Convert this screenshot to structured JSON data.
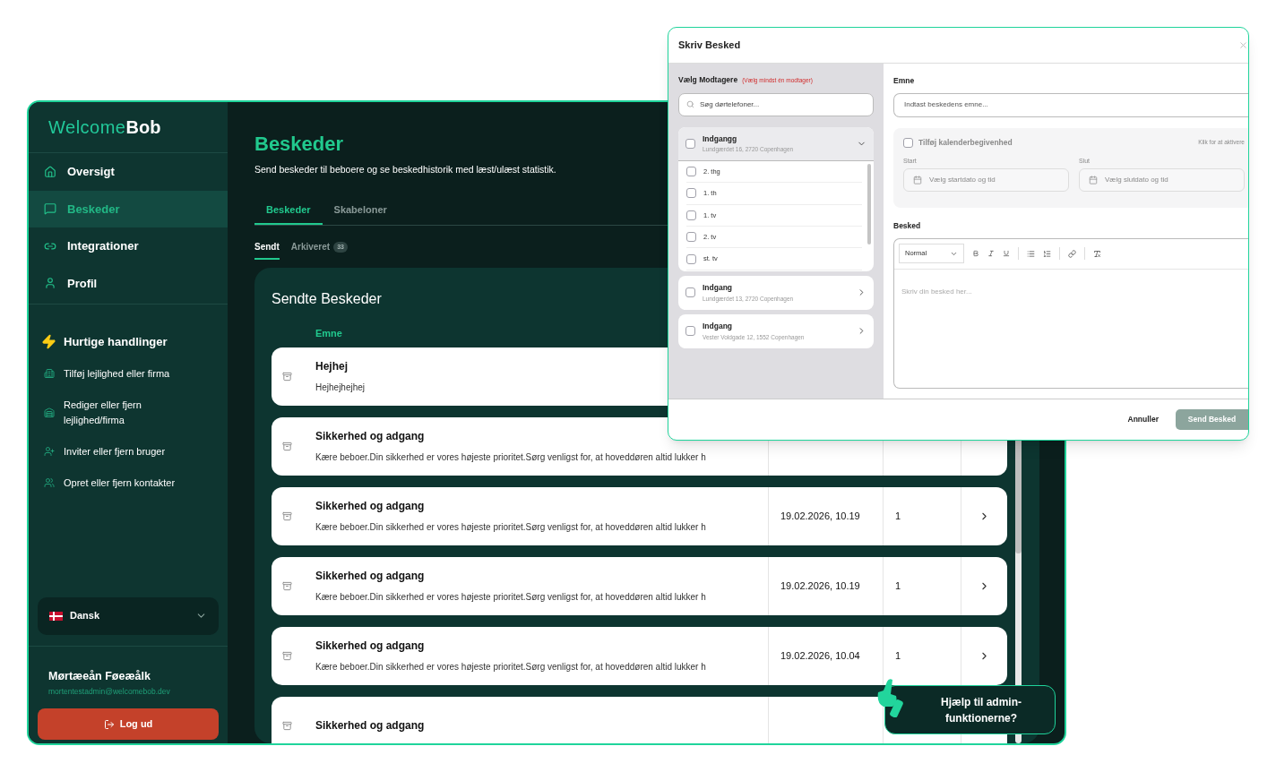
{
  "sidebar": {
    "logo": {
      "light": "Welcome",
      "bold": "Bob"
    },
    "nav": [
      {
        "label": "Oversigt",
        "selected": false
      },
      {
        "label": "Beskeder",
        "selected": true
      },
      {
        "label": "Integrationer",
        "selected": false
      },
      {
        "label": "Profil",
        "selected": false
      }
    ],
    "quick_actions": {
      "title": "Hurtige handlinger",
      "items": [
        "Tilføj lejlighed eller firma",
        "Rediger eller fjern lejlighed/firma",
        "Inviter eller fjern bruger",
        "Opret eller fjern kontakter"
      ]
    },
    "language": "Dansk",
    "user": {
      "name": "Mørtæeån Føeæålk",
      "email": "mortentestadmin@welcomebob.dev"
    },
    "logout": "Log ud"
  },
  "main": {
    "title": "Beskeder",
    "description": "Send beskeder til beboere og se beskedhistorik med læst/ulæst statistik.",
    "tabs": [
      {
        "label": "Beskeder",
        "selected": true
      },
      {
        "label": "Skabeloner",
        "selected": false
      }
    ],
    "subtabs": [
      {
        "label": "Sendt",
        "selected": true
      },
      {
        "label": "Arkiveret",
        "selected": false,
        "count": "33"
      }
    ],
    "card": {
      "title": "Sendte Beskeder",
      "columns": [
        "Emne"
      ],
      "rows": [
        {
          "subject": "Hejhej",
          "preview": "Hejhejhejhej"
        },
        {
          "subject": "Sikkerhed og adgang",
          "preview": "Kære beboer.Din sikkerhed er vores højeste prioritet.Sørg venligst for, at hoveddøren altid lukker h"
        },
        {
          "subject": "Sikkerhed og adgang",
          "preview": "Kære beboer.Din sikkerhed er vores højeste prioritet.Sørg venligst for, at hoveddøren altid lukker h",
          "date": "19.02.2026, 10.19",
          "count": "1"
        },
        {
          "subject": "Sikkerhed og adgang",
          "preview": "Kære beboer.Din sikkerhed er vores højeste prioritet.Sørg venligst for, at hoveddøren altid lukker h",
          "date": "19.02.2026, 10.19",
          "count": "1"
        },
        {
          "subject": "Sikkerhed og adgang",
          "preview": "Kære beboer.Din sikkerhed er vores højeste prioritet.Sørg venligst for, at hoveddøren altid lukker h",
          "date": "19.02.2026, 10.04",
          "count": "1"
        },
        {
          "subject": "Sikkerhed og adgang"
        }
      ]
    }
  },
  "help": "Hjælp til admin-funktionerne?",
  "modal": {
    "title": "Skriv Besked",
    "recipients": {
      "label": "Vælg Modtagere",
      "hint": "(Vælg mindst én modtager)",
      "search_placeholder": "Søg dørtelefoner...",
      "groups": [
        {
          "name": "Indgangg",
          "address": "Lundgærdet 16, 2720 Copenhagen",
          "checked": false,
          "expanded": true,
          "children": [
            {
              "label": "2. thg",
              "checked": false
            },
            {
              "label": "1. th",
              "checked": false
            },
            {
              "label": "1. tv",
              "checked": false
            },
            {
              "label": "2. tv",
              "checked": false
            },
            {
              "label": "st. tv",
              "checked": false
            }
          ]
        },
        {
          "name": "Indgang",
          "address": "Lundgærdet 13, 2720 Copenhagen",
          "checked": false,
          "expanded": false
        },
        {
          "name": "Indgang",
          "address": "Vester Voldgade 12, 1552 Copenhagen",
          "checked": false,
          "expanded": false
        }
      ]
    },
    "subject": {
      "label": "Emne",
      "placeholder": "Indtast beskedens emne..."
    },
    "calendar": {
      "label": "Tilføj kalenderbegivenhed",
      "checked": false,
      "disabled": true,
      "hint": "Klik for at aktivere",
      "fields": [
        {
          "label": "Start",
          "placeholder": "Vælg startdato og tid"
        },
        {
          "label": "Slut",
          "placeholder": "Vælg slutdato og tid"
        }
      ]
    },
    "message": {
      "label": "Besked",
      "format": "Normal",
      "placeholder": "Skriv din besked her..."
    },
    "cancel": "Annuller",
    "send": {
      "label": "Send Besked",
      "disabled": true
    }
  }
}
